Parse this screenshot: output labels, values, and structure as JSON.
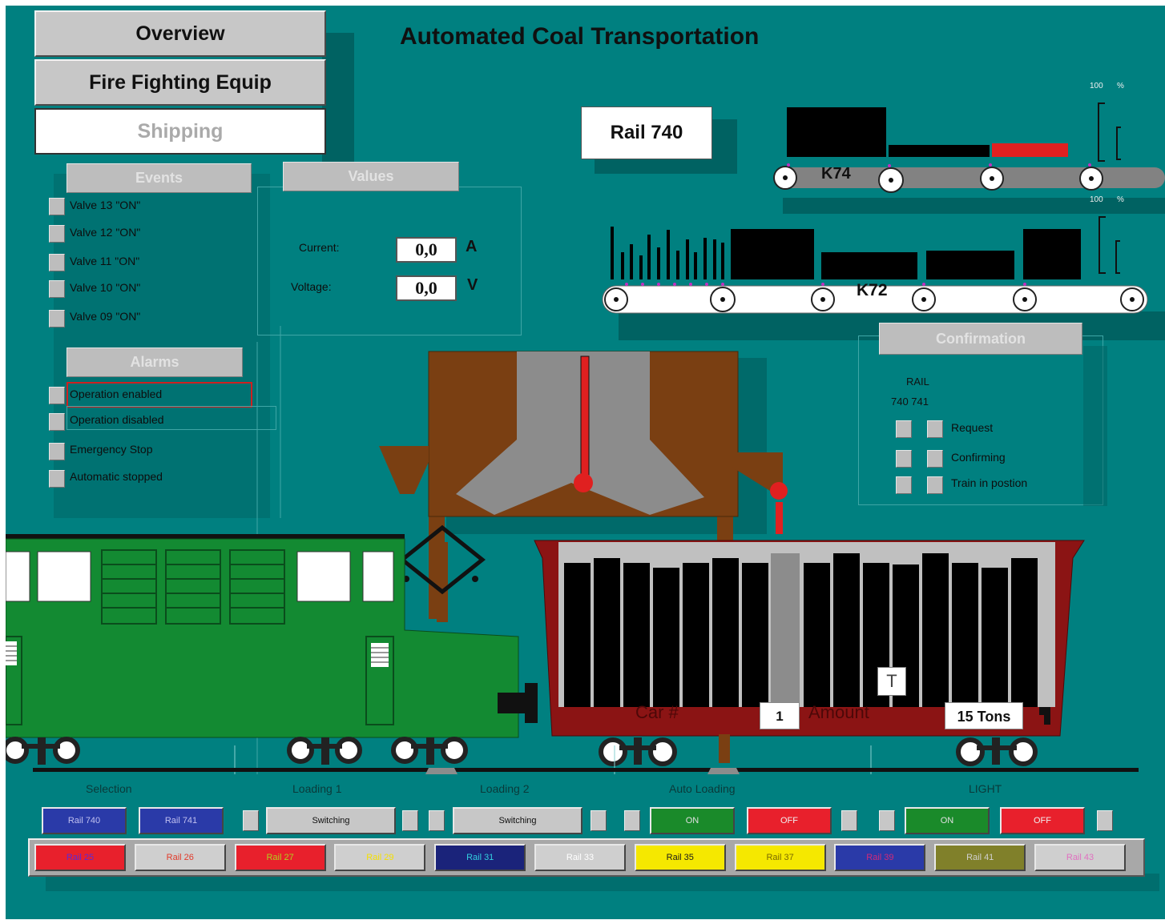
{
  "nav": {
    "overview": "Overview",
    "fire": "Fire Fighting Equip",
    "shipping": "Shipping"
  },
  "title": "Automated Coal Transportation",
  "rail_box": "Rail 740",
  "events": {
    "header": "Events",
    "items": [
      "Valve 13 \"ON\"",
      "Valve 12 \"ON\"",
      "Valve 11 \"ON\"",
      "Valve 10 \"ON\"",
      "Valve 09 \"ON\""
    ]
  },
  "alarms": {
    "header": "Alarms",
    "items": [
      "Operation enabled",
      "Operation disabled",
      "Emergency Stop",
      "Automatic stopped"
    ]
  },
  "values": {
    "header": "Values",
    "current_label": "Current:",
    "current_value": "0,0",
    "current_unit": "A",
    "voltage_label": "Voltage:",
    "voltage_value": "0,0",
    "voltage_unit": "V"
  },
  "conveyors": {
    "k74": {
      "label": "K74",
      "scale_max": "100",
      "scale_unit": "%"
    },
    "k72": {
      "label": "K72",
      "scale_max": "100",
      "scale_unit": "%"
    }
  },
  "confirmation": {
    "header": "Confirmation",
    "rail_label": "RAIL",
    "rail_ids": "740 741",
    "items": [
      "Request",
      "Confirming",
      "Train in postion"
    ]
  },
  "wagon": {
    "car_label": "Car #",
    "car_value": "1",
    "amount_label": "Amount",
    "amount_value": "15 Tons",
    "t_button": "T"
  },
  "sections": {
    "selection": "Selection",
    "loading1": "Loading 1",
    "loading2": "Loading 2",
    "auto": "Auto Loading",
    "light": "LIGHT"
  },
  "controls": {
    "rail740": "Rail 740",
    "rail741": "Rail 741",
    "switching1": "Switching",
    "switching2": "Switching",
    "auto_on": "ON",
    "auto_off": "OFF",
    "light_on": "ON",
    "light_off": "OFF"
  },
  "rails": [
    {
      "label": "Rail 25",
      "bg": "#e8202c",
      "fg": "#5a2bd4"
    },
    {
      "label": "Rail 26",
      "bg": "#cfcfcf",
      "fg": "#e23a2a"
    },
    {
      "label": "Rail 27",
      "bg": "#e8202c",
      "fg": "#b0d020"
    },
    {
      "label": "Rail 29",
      "bg": "#cfcfcf",
      "fg": "#f5e000"
    },
    {
      "label": "Rail 31",
      "bg": "#1a237a",
      "fg": "#33d0e0"
    },
    {
      "label": "Rail 33",
      "bg": "#cfcfcf",
      "fg": "#ffffff"
    },
    {
      "label": "Rail 35",
      "bg": "#f5e800",
      "fg": "#1a1a1a"
    },
    {
      "label": "Rail 37",
      "bg": "#f5e800",
      "fg": "#7a6a00"
    },
    {
      "label": "Rail 39",
      "bg": "#2a3aa8",
      "fg": "#d02a7a"
    },
    {
      "label": "Rail 41",
      "bg": "#80802a",
      "fg": "#d0d0d0"
    },
    {
      "label": "Rail 43",
      "bg": "#cfcfcf",
      "fg": "#e070c0"
    }
  ],
  "colors": {
    "background": "#008080",
    "panel": "#bdbdbd",
    "alarm_highlight": "#d02020"
  }
}
